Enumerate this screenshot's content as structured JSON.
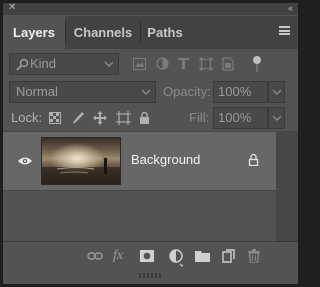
{
  "window": {
    "close_glyph": "✕",
    "collapse_glyph": "‹‹"
  },
  "tabs": [
    {
      "label": "Layers",
      "active": true
    },
    {
      "label": "Channels",
      "active": false
    },
    {
      "label": "Paths",
      "active": false
    }
  ],
  "filter": {
    "kind_label": "Kind"
  },
  "blend": {
    "mode_value": "Normal",
    "opacity_label": "Opacity:",
    "opacity_value": "100%"
  },
  "lock": {
    "lock_label": "Lock:",
    "fill_label": "Fill:",
    "fill_value": "100%"
  },
  "layers": [
    {
      "name": "Background",
      "visible": true,
      "locked": true
    }
  ],
  "footer": {
    "fx_label": "fx"
  },
  "colors": {
    "panel_bg": "#535353",
    "tab_bar_bg": "#424242",
    "selected_layer_bg": "#676767"
  }
}
